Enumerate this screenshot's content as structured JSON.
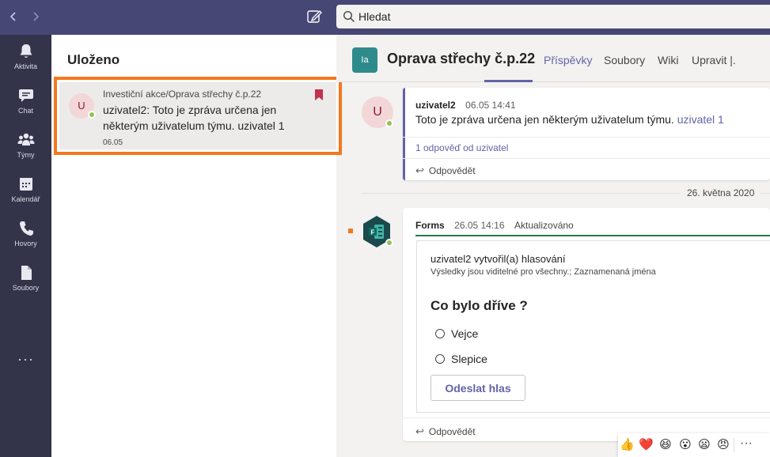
{
  "search": {
    "placeholder": "Hledat"
  },
  "rail": {
    "items": [
      {
        "label": "Aktivita",
        "icon": "bell-icon"
      },
      {
        "label": "Chat",
        "icon": "chat-icon"
      },
      {
        "label": "Týmy",
        "icon": "teams-icon"
      },
      {
        "label": "Kalendář",
        "icon": "calendar-icon"
      },
      {
        "label": "Hovory",
        "icon": "phone-icon"
      },
      {
        "label": "Soubory",
        "icon": "file-icon"
      }
    ],
    "more": "···"
  },
  "saved": {
    "title": "Uloženo",
    "item": {
      "avatar": "U",
      "channel": "Investiční akce/Oprava střechy č.p.22",
      "message": "uzivatel2: Toto je zpráva určena jen některým uživatelum týmu. uzivatel 1",
      "time": "06.05"
    }
  },
  "channel": {
    "tile": "Ia",
    "title": "Oprava střechy č.p.22",
    "tabs": [
      "Příspěvky",
      "Soubory",
      "Wiki",
      "Upravit |."
    ]
  },
  "message1": {
    "avatar": "U",
    "author": "uzivatel2",
    "time": "06.05 14:41",
    "text": "Toto je zpráva určena jen některým uživatelum týmu.",
    "mention": "uzivatel 1",
    "reply_count": "1 odpověď od uzivatel",
    "reply": "Odpovědět"
  },
  "date_separator": "26. května 2020",
  "message2": {
    "author": "Forms",
    "time": "26.05 14:16",
    "status": "Aktualizováno",
    "created": "uzivatel2 vytvořil(a) hlasování",
    "visibility": "Výsledky jsou viditelné pro všechny.; Zaznamenaná jména",
    "question": "Co bylo dříve ?",
    "options": [
      "Vejce",
      "Slepice"
    ],
    "submit": "Odeslat hlas",
    "reply": "Odpovědět"
  },
  "reactions": [
    "👍",
    "❤️",
    "😆",
    "😮",
    "😦",
    "😠"
  ],
  "reactions_more": "···"
}
